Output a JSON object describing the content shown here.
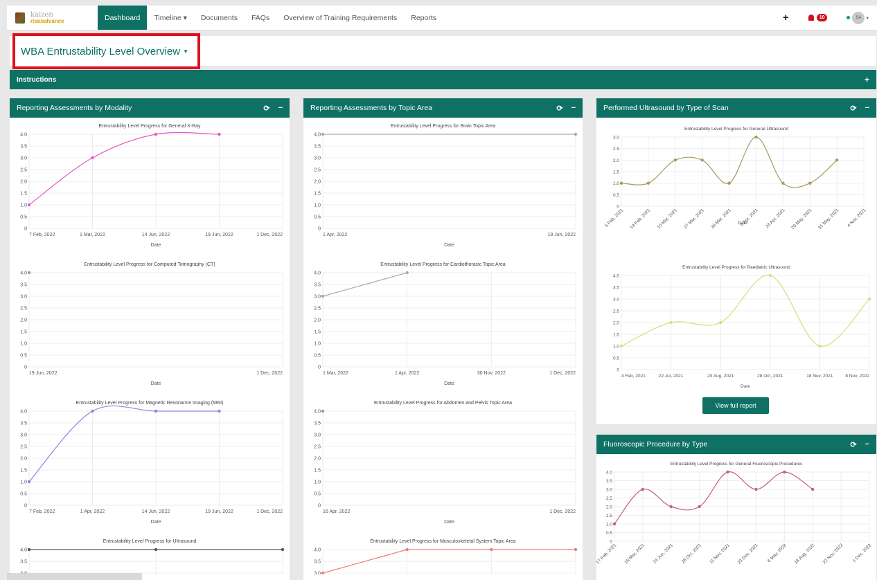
{
  "nav": {
    "brand_line1": "kaizen",
    "brand_line2": "rise/advance",
    "items": [
      "Dashboard",
      "Timeline ▾",
      "Documents",
      "FAQs",
      "Overview of Training Requirements",
      "Reports"
    ],
    "add_label": "+",
    "notifications_count": "10",
    "avatar_initials": "SA"
  },
  "page": {
    "title": "WBA Entrustability Level Overview"
  },
  "instructions": {
    "label": "Instructions",
    "toggle": "+"
  },
  "panels": {
    "modality": "Reporting Assessments by Modality",
    "topic": "Reporting Assessments by Topic Area",
    "ultrasound": "Performed Ultrasound by Type of Scan",
    "fluoro": "Fluoroscopic Procedure by Type"
  },
  "panel_tools": {
    "refresh": "⟳",
    "collapse": "−"
  },
  "view_full_report": "View full report",
  "colors": {
    "accent": "#0e7164",
    "highlight": "#e0101f"
  },
  "chart_data": [
    {
      "panel": "modality",
      "type": "line",
      "title": "Entrustability Level Progress for General X-Ray",
      "xlabel": "Date",
      "ylabel": "",
      "color": "#e35cc2",
      "x": [
        "7 Feb, 2022",
        "1 Mar, 2022",
        "14 Jun, 2022",
        "19 Jun, 2022"
      ],
      "y": [
        1.0,
        3.0,
        4.0,
        4.0
      ],
      "xticks": [
        "7 Feb, 2022",
        "1 Mar, 2022",
        "14 Jun, 2022",
        "19 Jun, 2022",
        "1 Dec, 2022"
      ],
      "ylim": [
        0,
        4.0
      ],
      "yticks": [
        "4.0",
        "3.5",
        "3.0",
        "2.5",
        "2.0",
        "1.5",
        "1.0",
        "0.5",
        "0"
      ]
    },
    {
      "panel": "modality",
      "type": "line",
      "title": "Entrustability Level Progress for Computed Tomography (CT)",
      "xlabel": "Date",
      "ylabel": "",
      "color": "#999999",
      "x": [
        "19 Jun, 2022"
      ],
      "y": [
        4.0
      ],
      "xticks": [
        "19 Jun, 2022",
        "1 Dec, 2022"
      ],
      "ylim": [
        0,
        4.0
      ],
      "yticks": [
        "4.0",
        "3.5",
        "3.0",
        "2.5",
        "2.0",
        "1.5",
        "1.0",
        "0.5",
        "0"
      ]
    },
    {
      "panel": "modality",
      "type": "line",
      "title": "Entrustability Level Progress for Magnetic Resonance Imaging (MRI)",
      "xlabel": "Date",
      "ylabel": "",
      "color": "#8a86e0",
      "x": [
        "7 Feb, 2022",
        "1 Apr, 2022",
        "14 Jun, 2022",
        "19 Jun, 2022"
      ],
      "y": [
        1.0,
        4.0,
        4.0,
        4.0
      ],
      "xticks": [
        "7 Feb, 2022",
        "1 Apr, 2022",
        "14 Jun, 2022",
        "19 Jun, 2022",
        "1 Dec, 2022"
      ],
      "ylim": [
        0,
        4.0
      ],
      "yticks": [
        "4.0",
        "3.5",
        "3.0",
        "2.5",
        "2.0",
        "1.5",
        "1.0",
        "0.5",
        "0"
      ]
    },
    {
      "panel": "modality",
      "type": "line",
      "title": "Entrustability Level Progress for Ultrasound",
      "xlabel": "Date",
      "ylabel": "",
      "color": "#555555",
      "x": [
        "1 Apr, 2022",
        "14 Jun, 2022",
        "19 Jun, 2022"
      ],
      "y": [
        4.0,
        4.0,
        4.0
      ],
      "xticks": [],
      "ylim": [
        0,
        4.0
      ],
      "yticks": [
        "4.0",
        "3.5",
        "3.0"
      ]
    },
    {
      "panel": "topic",
      "type": "line",
      "title": "Entrustability Level Progress for Brain Topic Area",
      "xlabel": "Date",
      "ylabel": "",
      "color": "#aaaaaa",
      "x": [
        "1 Apr, 2022",
        "19 Jun, 2022"
      ],
      "y": [
        4.0,
        4.0
      ],
      "xticks": [
        "1 Apr, 2022",
        "19 Jun, 2022"
      ],
      "ylim": [
        0,
        4.0
      ],
      "yticks": [
        "4.0",
        "3.5",
        "3.0",
        "2.5",
        "2.0",
        "1.5",
        "1.0",
        "0.5",
        "0"
      ]
    },
    {
      "panel": "topic",
      "type": "line",
      "title": "Entrustability Level Progress for Cardiothoracic Topic Area",
      "xlabel": "Date",
      "ylabel": "",
      "color": "#aaaaaa",
      "x": [
        "1 Mar, 2022",
        "1 Apr, 2022"
      ],
      "y": [
        3.0,
        4.0
      ],
      "xticks": [
        "1 Mar, 2022",
        "1 Apr, 2022",
        "30 Nov, 2022",
        "1 Dec, 2022"
      ],
      "ylim": [
        0,
        4.0
      ],
      "yticks": [
        "4.0",
        "3.5",
        "3.0",
        "2.5",
        "2.0",
        "1.5",
        "1.0",
        "0.5",
        "0"
      ]
    },
    {
      "panel": "topic",
      "type": "line",
      "title": "Entrustability Level Progress for Abdomen and Pelvis Topic Area",
      "xlabel": "Date",
      "ylabel": "",
      "color": "#999999",
      "x": [
        "16 Apr, 2022"
      ],
      "y": [
        4.0
      ],
      "xticks": [
        "16 Apr, 2022",
        "1 Dec, 2022"
      ],
      "ylim": [
        0,
        4.0
      ],
      "yticks": [
        "4.0",
        "3.5",
        "3.0",
        "2.5",
        "2.0",
        "1.5",
        "1.0",
        "0.5",
        "0"
      ]
    },
    {
      "panel": "topic",
      "type": "line",
      "title": "Entrustability Level Progress for Musculoskeletal System Topic Area",
      "xlabel": "Date",
      "ylabel": "",
      "color": "#ef7b7b",
      "x": [
        "1 Mar, 2022",
        "1 Apr, 2022",
        "30 Nov, 2022",
        "1 Dec, 2022"
      ],
      "y": [
        3.0,
        4.0,
        4.0,
        4.0
      ],
      "xticks": [],
      "ylim": [
        0,
        4.0
      ],
      "yticks": [
        "4.0",
        "3.5",
        "3.0"
      ]
    },
    {
      "panel": "ultrasound",
      "type": "line",
      "title": "Entrustability Level Progress for General Ultrasound",
      "xlabel": "Date",
      "ylabel": "",
      "color": "#a89a5a",
      "x": [
        "5 Feb, 2021",
        "19 Feb, 2021",
        "10 Mar, 2021",
        "27 Mar, 2021",
        "30 Mar, 2021",
        "9 Apr, 2021",
        "23 Apr, 2021",
        "20 May, 2021",
        "31 May, 2021"
      ],
      "y": [
        1.0,
        1.0,
        2.0,
        2.0,
        1.0,
        3.0,
        1.0,
        1.0,
        2.0
      ],
      "xticks": [
        "5 Feb, 2021",
        "19 Feb, 2021",
        "10 Mar, 2021",
        "27 Mar, 2021",
        "30 Mar, 2021",
        "9 Apr, 2021",
        "23 Apr, 2021",
        "20 May, 2021",
        "31 May, 2021",
        "4 Nov, 2021"
      ],
      "ylim": [
        0,
        3.0
      ],
      "yticks": [
        "3.0",
        "2.5",
        "2.0",
        "1.5",
        "1.0",
        "0.5",
        "0"
      ]
    },
    {
      "panel": "ultrasound",
      "type": "line",
      "title": "Entrustability Level Progress for Paediatric Ultrasound",
      "xlabel": "Date",
      "ylabel": "",
      "color": "#d2e07a",
      "x": [
        "4 Feb, 2021",
        "22 Jul, 2021",
        "20 Aug, 2021",
        "28 Oct, 2021",
        "18 Nov, 2021",
        "8 Nov, 2022"
      ],
      "y": [
        1.0,
        2.0,
        2.0,
        4.0,
        1.0,
        3.0
      ],
      "xticks": [
        "4 Feb, 2021",
        "22 Jul, 2021",
        "20 Aug, 2021",
        "28 Oct, 2021",
        "18 Nov, 2021",
        "8 Nov, 2022"
      ],
      "ylim": [
        0,
        4.0
      ],
      "yticks": [
        "4.0",
        "3.5",
        "3.0",
        "2.5",
        "2.0",
        "1.5",
        "1.0",
        "0.5",
        "0"
      ]
    },
    {
      "panel": "fluoro",
      "type": "line",
      "title": "Entrustability Level Progress for General Fluoroscopic Procedures",
      "xlabel": "",
      "ylabel": "",
      "color": "#c2607a",
      "x": [
        "17 Feb, 2021",
        "18 Mar, 2021",
        "24 Jun, 2021",
        "28 Oct, 2021",
        "11 Nov, 2021",
        "23 Dec, 2021",
        "6 May, 2022",
        "18 Aug, 2022"
      ],
      "y": [
        1.0,
        3.0,
        2.0,
        2.0,
        4.0,
        3.0,
        4.0,
        3.0
      ],
      "xticks": [
        "17 Feb, 2021",
        "18 Mar, 2021",
        "24 Jun, 2021",
        "28 Oct, 2021",
        "11 Nov, 2021",
        "23 Dec, 2021",
        "6 May, 2022",
        "18 Aug, 2022",
        "22 Nov, 2022",
        "1 Dec, 2022"
      ],
      "ylim": [
        0,
        4.0
      ],
      "yticks": [
        "4.0",
        "3.5",
        "3.0",
        "2.5",
        "2.0",
        "1.5",
        "1.0",
        "0.5",
        "0"
      ]
    }
  ]
}
